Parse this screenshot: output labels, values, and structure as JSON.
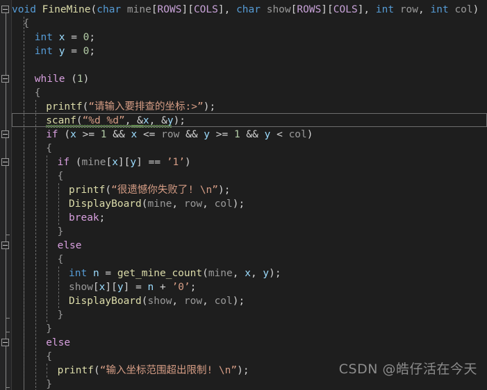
{
  "editor": {
    "background": "#1e1e1e",
    "gutter_background": "#252526",
    "font_size_px": 14.5,
    "line_height_px": 20,
    "current_line_index": 8,
    "language": "C"
  },
  "colors": {
    "keyword": "#569cd6",
    "control": "#d8a0df",
    "function": "#dcdcaa",
    "string": "#d69d85",
    "number": "#b5cea8",
    "macro": "#c8a2d8",
    "variable": "#9cdcfe",
    "identifier": "#9a9a9a",
    "punctuation": "#d4d4d4",
    "squiggle": "#6a9955",
    "watermark": "#8c8c8c"
  },
  "lines": [
    {
      "indent": 0,
      "text": "void FineMine(char mine[ROWS][COLS], char show[ROWS][COLS], int row, int col)"
    },
    {
      "indent": 1,
      "text": "{"
    },
    {
      "indent": 2,
      "text": "int x = 0;"
    },
    {
      "indent": 2,
      "text": "int y = 0;"
    },
    {
      "indent": 2,
      "text": ""
    },
    {
      "indent": 2,
      "text": "while (1)"
    },
    {
      "indent": 2,
      "text": "{"
    },
    {
      "indent": 3,
      "text": "printf(“请输入要排查的坐标:>”);"
    },
    {
      "indent": 3,
      "text": "scanf(“%d %d”, &x, &y);"
    },
    {
      "indent": 3,
      "text": "if (x >= 1 && x <= row && y >= 1 && y < col)"
    },
    {
      "indent": 3,
      "text": "{"
    },
    {
      "indent": 4,
      "text": "if (mine[x][y] == ’1’)"
    },
    {
      "indent": 4,
      "text": "{"
    },
    {
      "indent": 5,
      "text": "printf(“很遗憾你失败了! \\n”);"
    },
    {
      "indent": 5,
      "text": "DisplayBoard(mine, row, col);"
    },
    {
      "indent": 5,
      "text": "break;"
    },
    {
      "indent": 4,
      "text": "}"
    },
    {
      "indent": 4,
      "text": "else"
    },
    {
      "indent": 4,
      "text": "{"
    },
    {
      "indent": 5,
      "text": "int n = get_mine_count(mine, x, y);"
    },
    {
      "indent": 5,
      "text": "show[x][y] = n + ’0’;"
    },
    {
      "indent": 5,
      "text": "DisplayBoard(show, row, col);"
    },
    {
      "indent": 4,
      "text": "}"
    },
    {
      "indent": 3,
      "text": "}"
    },
    {
      "indent": 3,
      "text": "else"
    },
    {
      "indent": 3,
      "text": "{"
    },
    {
      "indent": 4,
      "text": "printf(“输入坐标范围超出限制! \\n”);"
    },
    {
      "indent": 3,
      "text": "}"
    }
  ],
  "fold_markers": [
    {
      "line": 0,
      "state": "expanded",
      "glyph": "minus"
    },
    {
      "line": 5,
      "state": "expanded",
      "glyph": "minus"
    },
    {
      "line": 9,
      "state": "expanded",
      "glyph": "minus"
    },
    {
      "line": 11,
      "state": "expanded",
      "glyph": "minus"
    },
    {
      "line": 17,
      "state": "expanded",
      "glyph": "minus"
    },
    {
      "line": 24,
      "state": "expanded",
      "glyph": "minus"
    }
  ],
  "diagnostics": [
    {
      "line": 8,
      "token": "scanf",
      "severity": "warning",
      "style": "green-squiggle"
    },
    {
      "line": 8,
      "token": "&x",
      "severity": "warning",
      "style": "green-squiggle"
    },
    {
      "line": 8,
      "token": "&y",
      "severity": "warning",
      "style": "green-squiggle"
    }
  ],
  "watermark": {
    "text": "CSDN @皓仔活在今天"
  }
}
